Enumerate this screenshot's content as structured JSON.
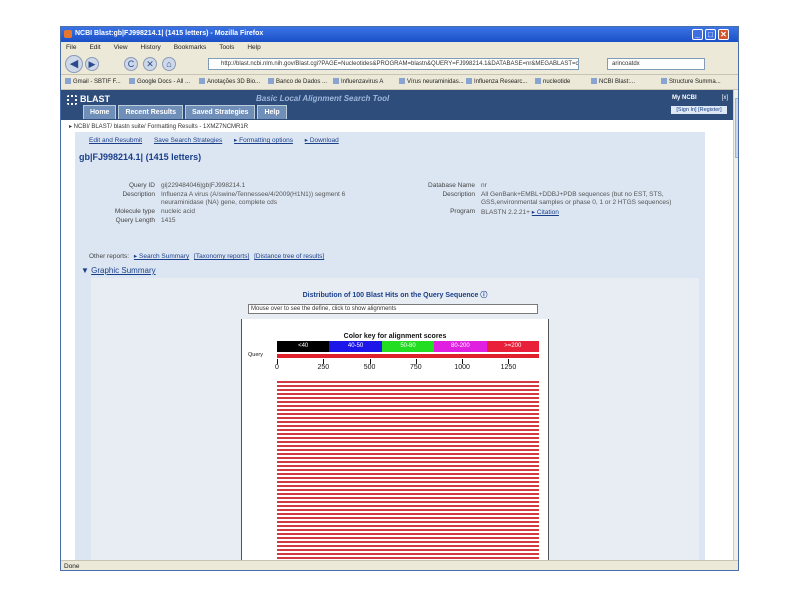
{
  "window": {
    "title": "NCBI Blast:gb|FJ998214.1| (1415 letters) - Mozilla Firefox",
    "controls": {
      "minimize": "_",
      "maximize": "□",
      "close": "✕"
    }
  },
  "menu": [
    "File",
    "Edit",
    "View",
    "History",
    "Bookmarks",
    "Tools",
    "Help"
  ],
  "nav": {
    "back": "◀",
    "forward": "▶",
    "reload": "C",
    "stop": "✕",
    "home": "⌂",
    "url": "http://blast.ncbi.nlm.nih.gov/Blast.cgi?PAGE=Nucleotides&PROGRAM=blastn&QUERY=FJ998214.1&DATABASE=nr&MEGABLAST=on",
    "search_placeholder": "arincoatdx"
  },
  "bookmarks": [
    "Gmail - SBTIF F...",
    "Google Docs - All ...",
    "Anotações 3D Bio...",
    "Banco de Dados ...",
    "Influenzavirus A",
    "Vírus neuraminidas...",
    "Influenza Researc...",
    "nucleotide",
    "NCBI Blast:...",
    "Structure Summa..."
  ],
  "blast": {
    "logo": "BLAST",
    "tagline": "Basic Local Alignment Search Tool",
    "tabs": [
      "Home",
      "Recent Results",
      "Saved Strategies",
      "Help"
    ],
    "myncbi_title": "My NCBI",
    "myncbi_close": "[x]",
    "myncbi_links": "[Sign In] [Register]",
    "breadcrumb": "▸ NCBI/ BLAST/ blastn suite/ Formatting Results - 1XMZ7NCMR1R",
    "links": [
      "Edit and Resubmit",
      "Save Search Strategies",
      "▸ Formatting options",
      "▸ Download"
    ],
    "query_title": "gb|FJ998214.1| (1415 letters)",
    "query": {
      "id_label": "Query ID",
      "id": "gi|229484046|gb|FJ998214.1",
      "desc_label": "Description",
      "desc1": "Influenza A virus (A/swine/Tennessee/4/2009(H1N1)) segment 6",
      "desc2": "neuraminidase (NA) gene, complete cds",
      "moltype_label": "Molecule type",
      "moltype": "nucleic acid",
      "length_label": "Query Length",
      "length": "1415"
    },
    "db": {
      "name_label": "Database Name",
      "name": "nr",
      "desc_label": "Description",
      "desc1": "All GenBank+EMBL+DDBJ+PDB sequences (but no EST, STS,",
      "desc2": "GSS,environmental samples or phase 0, 1 or 2 HTGS sequences)",
      "program_label": "Program",
      "program": "BLASTN 2.2.21+",
      "citation": "▸ Citation"
    },
    "other_reports_label": "Other reports:",
    "other_reports": [
      "▸ Search Summary",
      "[Taxonomy reports]",
      "[Distance tree of results]"
    ],
    "graphic_summary": "Graphic Summary",
    "distribution_title": "Distribution of 100 Blast Hits on the Query Sequence",
    "mouseover": "Mouse over to see the define, click to show alignments",
    "color_key_title": "Color key for alignment scores",
    "query_label": "Query",
    "hit_count": 100
  },
  "chart_data": {
    "type": "bar",
    "title": "Distribution of 100 Blast Hits on the Query Sequence",
    "color_key": [
      {
        "label": "<40",
        "color": "#000000"
      },
      {
        "label": "40-50",
        "color": "#1c17e8"
      },
      {
        "label": "50-80",
        "color": "#22dd22"
      },
      {
        "label": "80-200",
        "color": "#e020e0"
      },
      {
        "label": ">=200",
        "color": "#e8203a"
      }
    ],
    "axis_ticks": [
      "0",
      "250",
      "500",
      "750",
      "1000",
      "1250"
    ],
    "xlim": [
      0,
      1415
    ],
    "hit_color": "#d23a43"
  },
  "status": "Done"
}
